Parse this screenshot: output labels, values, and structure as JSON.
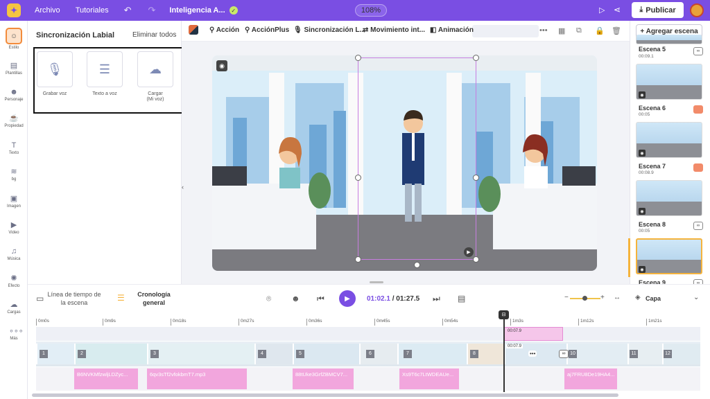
{
  "topbar": {
    "menu_file": "Archivo",
    "menu_tutorials": "Tutoriales",
    "project_name": "Inteligencia A...",
    "zoom": "108%",
    "publish_label": "Publicar"
  },
  "leftnav": [
    {
      "label": "Estilo",
      "icon": "character-face-icon"
    },
    {
      "label": "Plantillas",
      "icon": "templates-icon"
    },
    {
      "label": "Personaje",
      "icon": "person-icon"
    },
    {
      "label": "Propiedad",
      "icon": "property-icon"
    },
    {
      "label": "Texto",
      "icon": "text-icon"
    },
    {
      "label": "bg",
      "icon": "background-icon"
    },
    {
      "label": "Imagen",
      "icon": "image-icon"
    },
    {
      "label": "Video",
      "icon": "video-icon"
    },
    {
      "label": "Música",
      "icon": "music-icon"
    },
    {
      "label": "Efecto",
      "icon": "effect-icon"
    },
    {
      "label": "Cargas",
      "icon": "upload-cloud-icon"
    },
    {
      "label": "Más",
      "icon": "more-dots-icon"
    }
  ],
  "panel": {
    "title": "Sincronización Labial",
    "action": "Eliminar todos",
    "options": [
      {
        "label": "Grabar voz",
        "icon": "microphone-icon"
      },
      {
        "label": "Texto a voz",
        "icon": "text-to-speech-icon"
      },
      {
        "label": "Cargar",
        "sublabel": "(Mi voz)",
        "icon": "upload-cloud-icon"
      }
    ]
  },
  "toolbar": {
    "tabs": [
      "Acción",
      "AcciónPlus",
      "Sincronización L...",
      "Movimiento int...",
      "Animación"
    ],
    "selected_tab": "Sincronización L..."
  },
  "scenes_panel": {
    "add_label": "+ Agregar escena",
    "scenes": [
      {
        "name": "Escena 5",
        "duration": "00:09.1"
      },
      {
        "name": "Escena 6",
        "duration": "00:05"
      },
      {
        "name": "Escena 7",
        "duration": "00:08.9"
      },
      {
        "name": "Escena 8",
        "duration": "00:05"
      },
      {
        "name": "Escena 9",
        "duration": ""
      }
    ],
    "selected_scene": "Escena 8"
  },
  "timeline": {
    "scene_timeline": "Línea de tiempo de la escena",
    "general_timeline": "Cronología general",
    "current_time": "01:02.1",
    "separator": " / ",
    "total_time": "01:27.5",
    "layer_label": "Capa",
    "ruler": [
      "0m0s",
      "0m9s",
      "0m18s",
      "0m27s",
      "0m36s",
      "0m45s",
      "0m54s",
      "1m3s",
      "1m12s",
      "1m21s"
    ],
    "track1_block": "00:07.9",
    "track2_label": "00:07.9",
    "segments": [
      "1",
      "2",
      "3",
      "4",
      "5",
      "6",
      "7",
      "8",
      "10",
      "11",
      "12"
    ],
    "audio_clips": [
      "B6NVKMfzwljLDZyc...",
      "6qv3sTf2vfokbmT7.mp3",
      "88tUke3GrfZBMCV7...",
      "Xs9T6c7LtWDEAUe...",
      "aj7FRU8De19HA4..."
    ]
  },
  "colors": {
    "brand": "#7a4ee3",
    "accent": "#f5b33c",
    "audio": "#f2a6dd"
  }
}
